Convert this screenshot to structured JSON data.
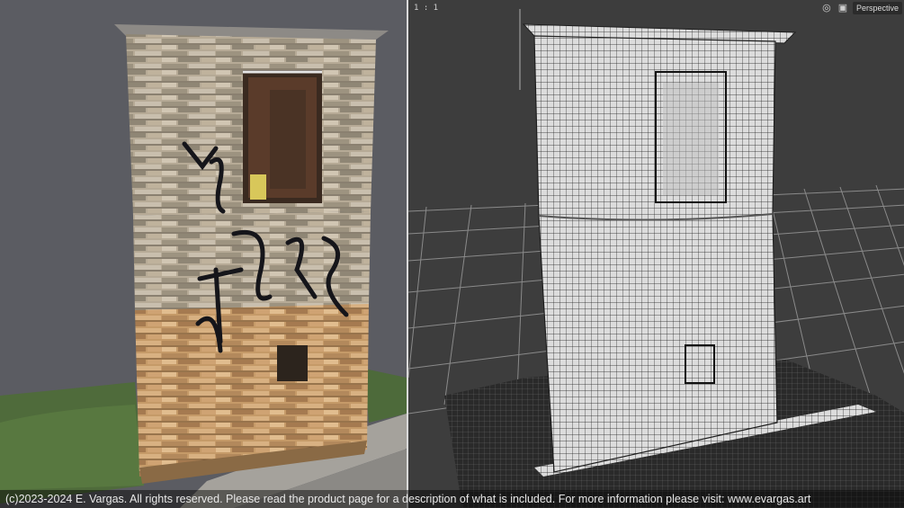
{
  "viewport": {
    "label": "1 : 1",
    "camera_label": "Perspective",
    "icons": [
      "globe-icon",
      "camera-icon"
    ]
  },
  "footer": {
    "copyright": "(c)2023-2024 E. Vargas. All rights reserved. Please read the product page for a description of what is included. For more information please visit: www.evargas.art"
  },
  "colors": {
    "viewport_bg": "#3d3d3d",
    "left_bg": "#5b5c62",
    "grid": "#8a8a8a",
    "mesh": "#1e1e1e"
  }
}
